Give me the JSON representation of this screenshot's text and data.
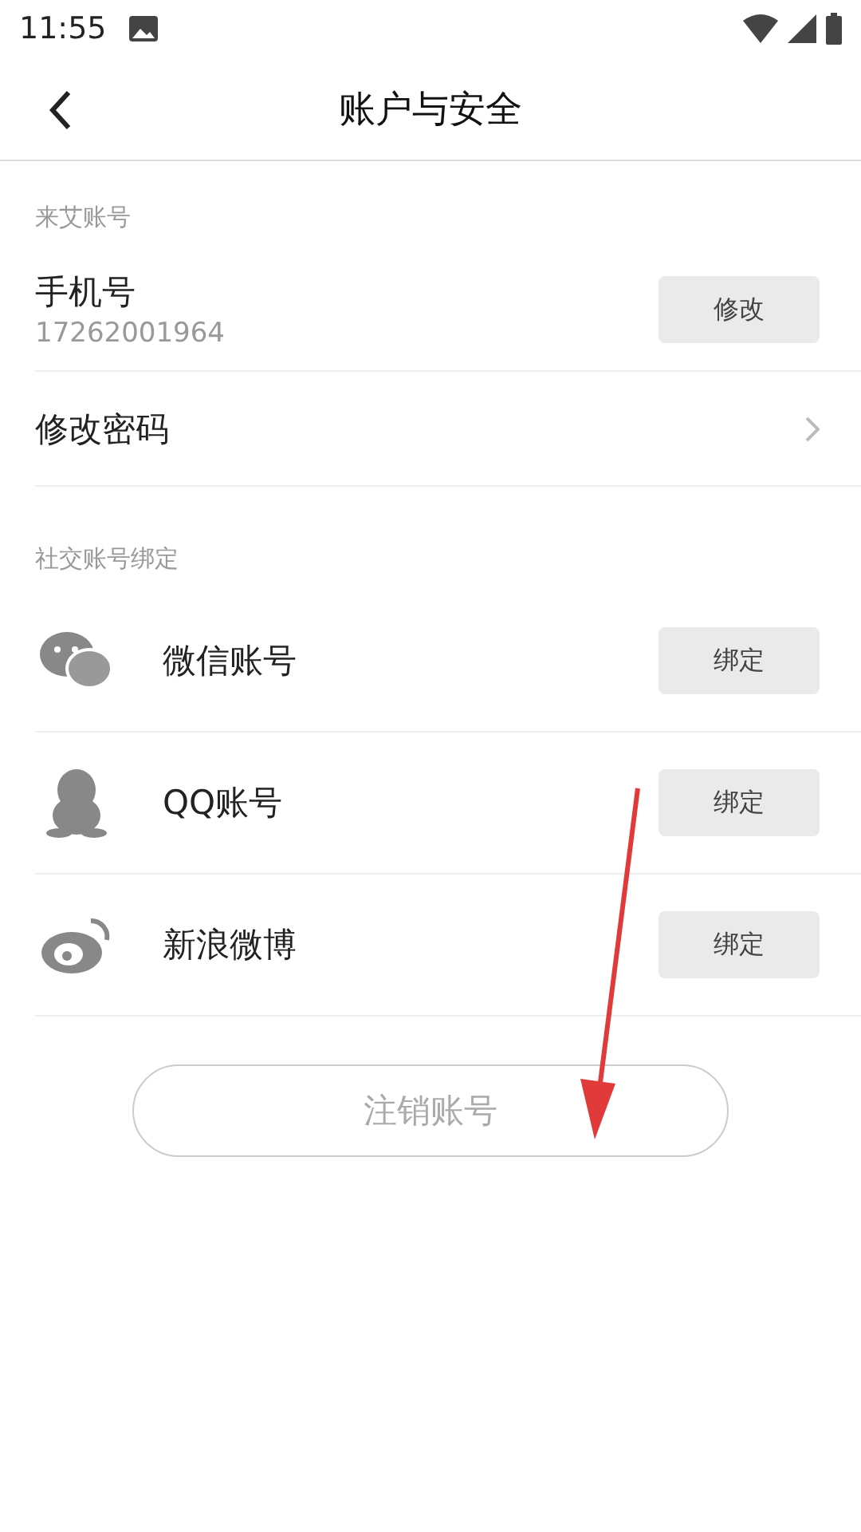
{
  "status_bar": {
    "time": "11:55"
  },
  "header": {
    "title": "账户与安全"
  },
  "account_section": {
    "label": "来艾账号"
  },
  "phone": {
    "label": "手机号",
    "value": "17262001964",
    "button": "修改"
  },
  "password": {
    "label": "修改密码"
  },
  "social_section": {
    "label": "社交账号绑定"
  },
  "social_accounts": [
    {
      "kind": "wechat",
      "label": "微信账号",
      "button": "绑定"
    },
    {
      "kind": "qq",
      "label": "QQ账号",
      "button": "绑定"
    },
    {
      "kind": "weibo",
      "label": "新浪微博",
      "button": "绑定"
    }
  ],
  "logout_button": "注销账号"
}
